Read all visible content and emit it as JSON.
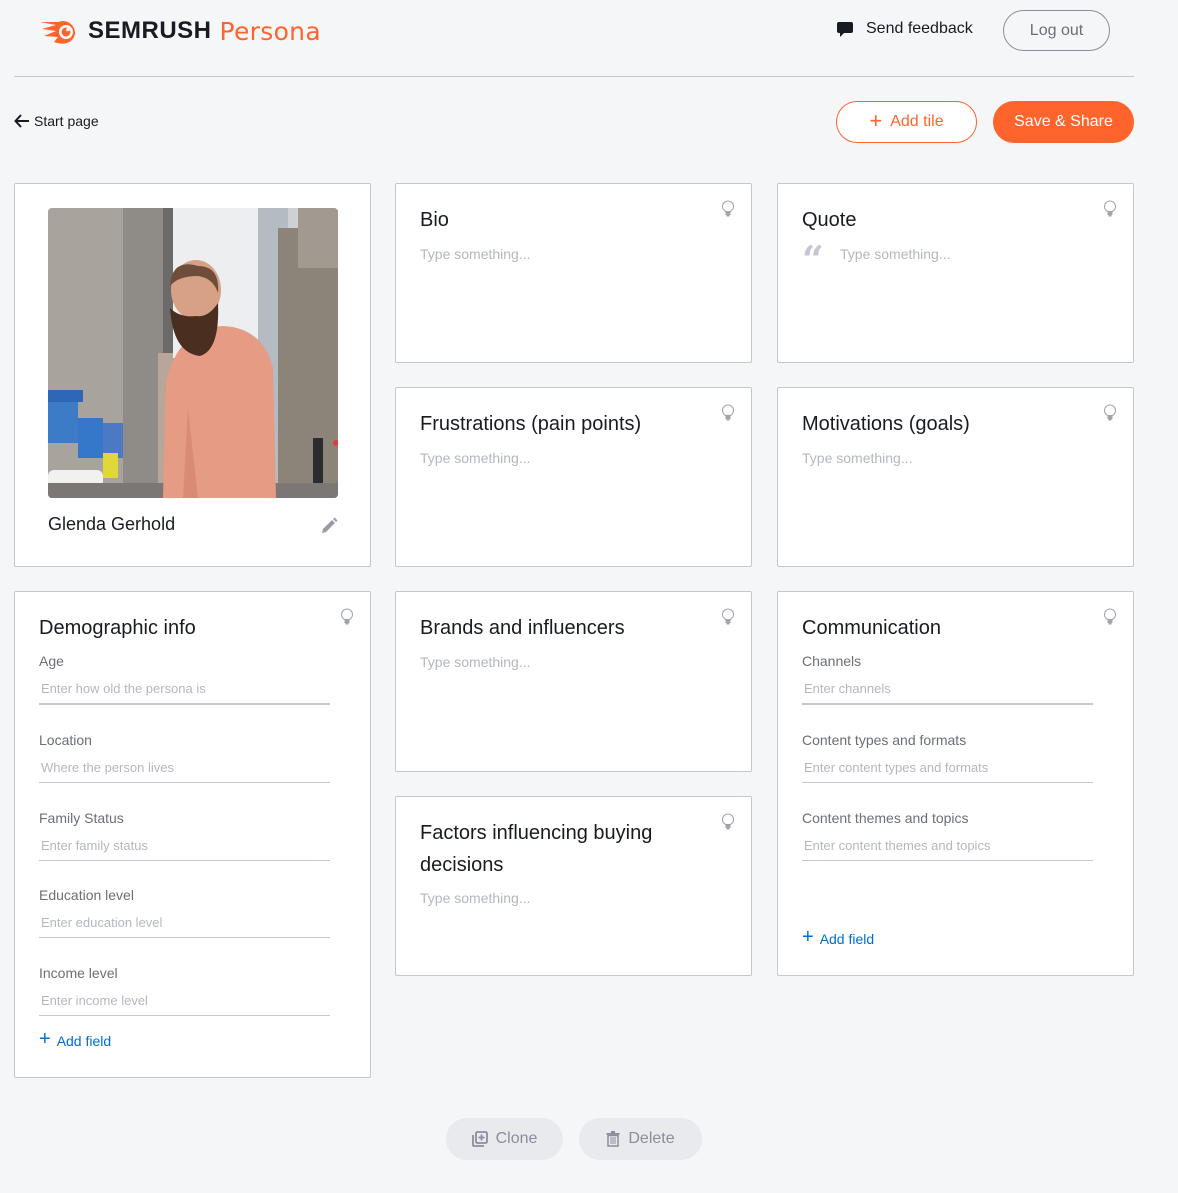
{
  "header": {
    "logo_text": "SEMRUSH",
    "logo_product": "Persona",
    "feedback_label": "Send feedback",
    "logout_label": "Log out"
  },
  "toolbar": {
    "back_label": "Start page",
    "add_tile_label": "Add tile",
    "save_share_label": "Save & Share"
  },
  "colors": {
    "brand_orange": "#ff642d",
    "link_blue": "#006dca",
    "background": "#f5f6f8"
  },
  "persona": {
    "name": "Glenda Gerhold",
    "photo_alt": "Bearded man in pink sweater on a city street"
  },
  "tiles": {
    "bio": {
      "title": "Bio",
      "placeholder": "Type something..."
    },
    "quote": {
      "title": "Quote",
      "placeholder": "Type something..."
    },
    "frustrations": {
      "title": "Frustrations (pain points)",
      "placeholder": "Type something..."
    },
    "motivations": {
      "title": "Motivations (goals)",
      "placeholder": "Type something..."
    },
    "brands": {
      "title": "Brands and influencers",
      "placeholder": "Type something..."
    },
    "factors": {
      "title": "Factors influencing buying decisions",
      "placeholder": "Type something..."
    },
    "demographic": {
      "title": "Demographic info",
      "fields": [
        {
          "label": "Age",
          "placeholder": "Enter how old the persona is",
          "value": ""
        },
        {
          "label": "Location",
          "placeholder": "Where the person lives",
          "value": ""
        },
        {
          "label": "Family Status",
          "placeholder": "Enter family status",
          "value": ""
        },
        {
          "label": "Education level",
          "placeholder": "Enter education level",
          "value": ""
        },
        {
          "label": "Income level",
          "placeholder": "Enter income level",
          "value": ""
        }
      ],
      "add_field_label": "Add field"
    },
    "communication": {
      "title": "Communication",
      "fields": [
        {
          "label": "Channels",
          "placeholder": "Enter channels",
          "value": ""
        },
        {
          "label": "Content types and formats",
          "placeholder": "Enter content types and formats",
          "value": ""
        },
        {
          "label": "Content themes and topics",
          "placeholder": "Enter content themes and topics",
          "value": ""
        }
      ],
      "add_field_label": "Add field"
    }
  },
  "footer": {
    "clone_label": "Clone",
    "delete_label": "Delete"
  }
}
